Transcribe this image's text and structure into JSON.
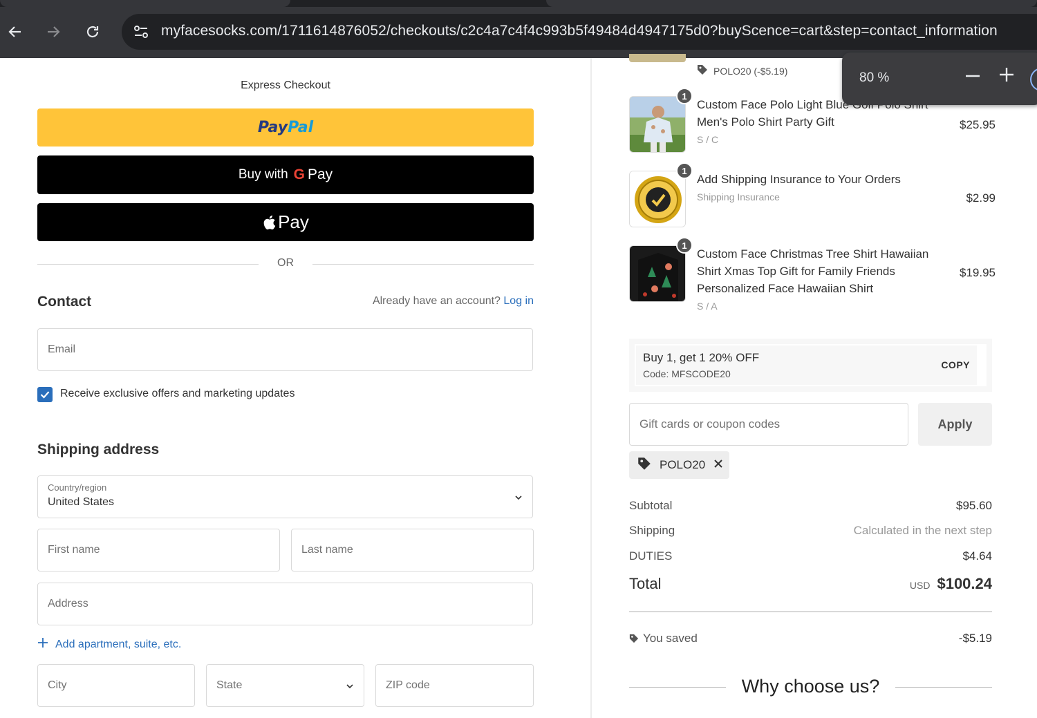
{
  "browser": {
    "url": "myfacesocks.com/1711614876052/checkouts/c2c4a7c4f4c993b5f49484d4947175d0?buyScence=cart&step=contact_information",
    "zoom_value": "80 %",
    "icons": [
      "back-arrow-icon",
      "forward-arrow-icon",
      "reload-icon",
      "site-info-icon",
      "zoom-minus-icon",
      "zoom-plus-icon"
    ]
  },
  "checkout": {
    "express_title": "Express Checkout",
    "paypal_part1": "Pay",
    "paypal_part2": "Pal",
    "gpay_prefix": "Buy with",
    "gpay_g": "G",
    "gpay_suffix": "Pay",
    "apple_pay_label": "Pay",
    "or_text": "OR",
    "contact_title": "Contact",
    "account_prompt": "Already have an account?",
    "login_link": "Log in",
    "email_placeholder": "Email",
    "marketing_label": "Receive exclusive offers and marketing updates",
    "marketing_checked": true,
    "shipping_title": "Shipping address",
    "country_label": "Country/region",
    "country_value": "United States",
    "first_name_placeholder": "First name",
    "last_name_placeholder": "Last name",
    "address_placeholder": "Address",
    "add_apartment": "Add apartment, suite, etc.",
    "city_placeholder": "City",
    "state_placeholder": "State",
    "zip_placeholder": "ZIP code"
  },
  "summary": {
    "top_discount_label": "POLO20 (-$5.19)",
    "items": [
      {
        "qty": "1",
        "name": "Custom Face Polo Light Blue Golf Polo Shirt Men's Polo Shirt Party Gift",
        "variant": "S / C",
        "price": "$25.95"
      },
      {
        "qty": "1",
        "name": "Add Shipping Insurance to Your Orders",
        "variant": "Shipping Insurance",
        "price": "$2.99"
      },
      {
        "qty": "1",
        "name": "Custom Face Christmas Tree Shirt Hawaiian Shirt Xmas Top Gift for Family Friends Personalized Face Hawaiian Shirt",
        "variant": "S / A",
        "price": "$19.95"
      }
    ],
    "promo": {
      "title": "Buy 1, get 1 20% OFF",
      "code": "Code: MFSCODE20",
      "copy_label": "COPY"
    },
    "coupon_placeholder": "Gift cards or coupon codes",
    "apply_label": "Apply",
    "applied_tag": "POLO20",
    "subtotal_label": "Subtotal",
    "subtotal_value": "$95.60",
    "shipping_label": "Shipping",
    "shipping_value": "Calculated in the next step",
    "duties_label": "DUTIES",
    "duties_value": "$4.64",
    "total_label": "Total",
    "total_currency": "USD",
    "total_value": "$100.24",
    "saved_label": "You saved",
    "saved_value": "-$5.19",
    "why_title": "Why choose us?"
  },
  "colors": {
    "paypal_yellow": "#ffc439",
    "link_blue": "#2a6ebb",
    "chrome_dark": "#35363a"
  }
}
